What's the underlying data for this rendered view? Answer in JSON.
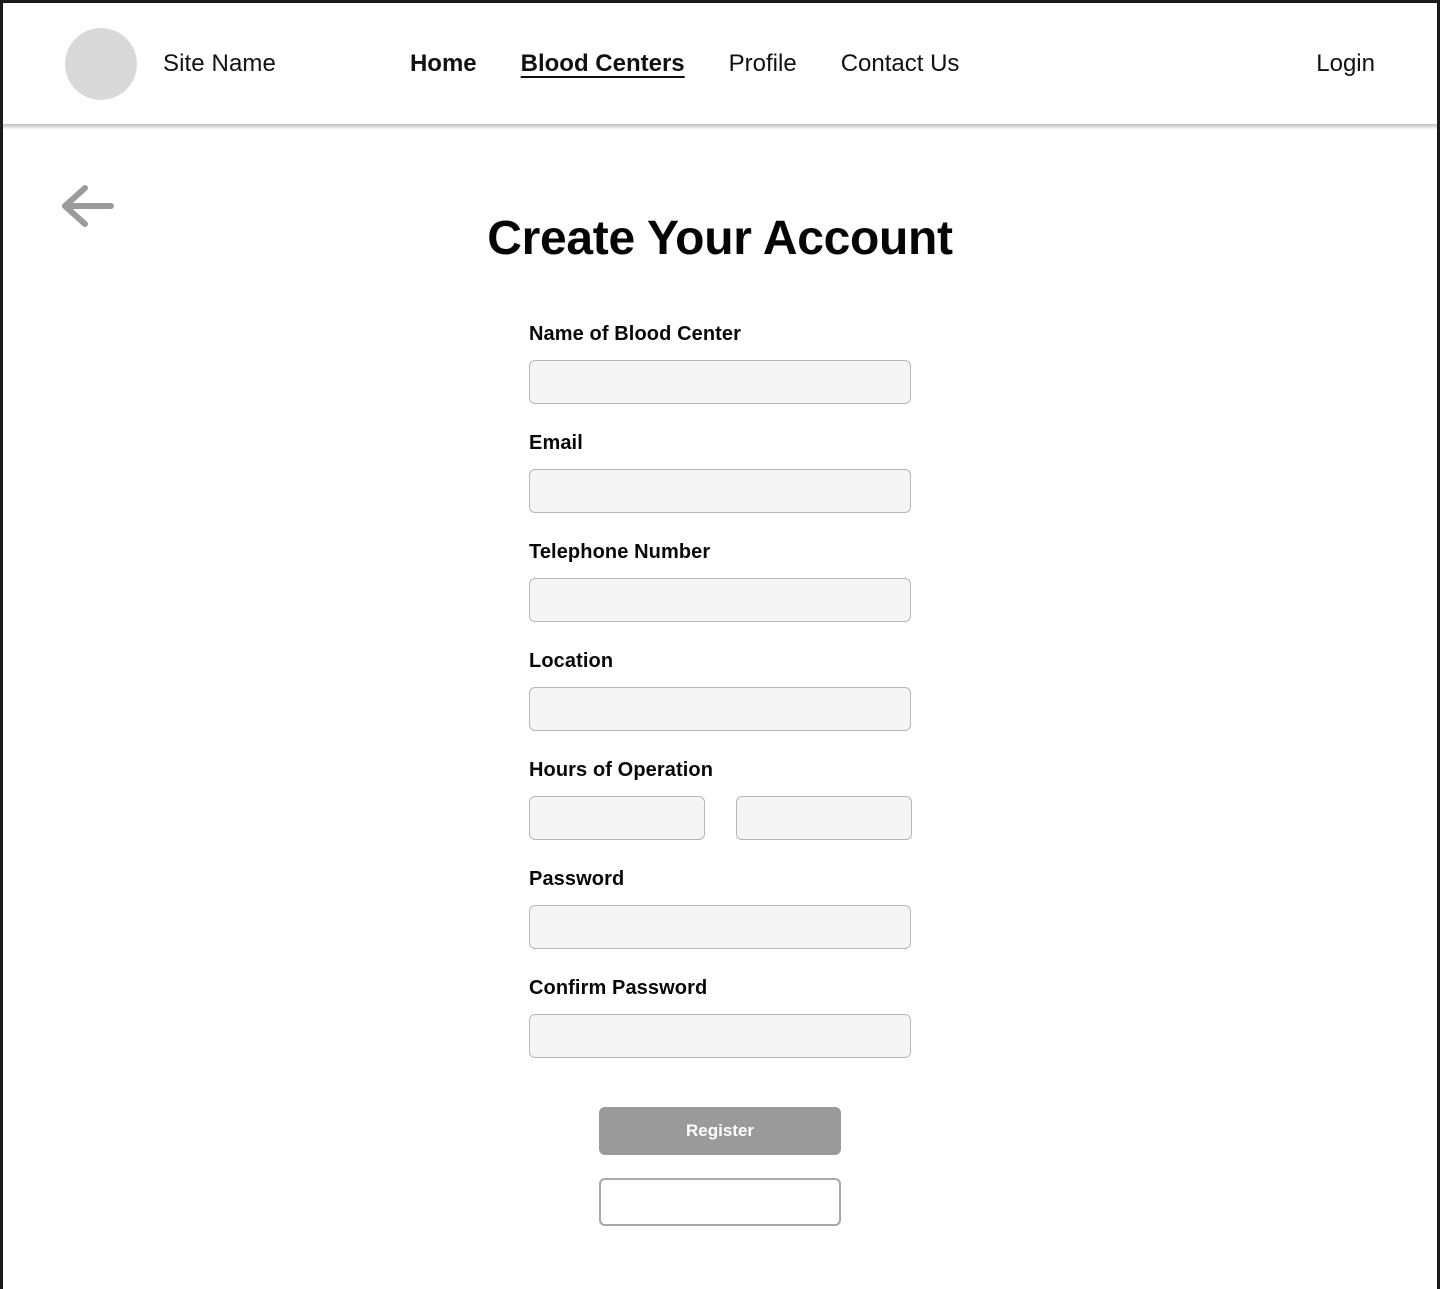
{
  "header": {
    "brand": {
      "logo_icon": "site-logo-circle",
      "name": "Site Name"
    },
    "nav": [
      {
        "label": "Home",
        "state": "strong"
      },
      {
        "label": "Blood Centers",
        "state": "active"
      },
      {
        "label": "Profile",
        "state": "normal"
      },
      {
        "label": "Contact Us",
        "state": "normal"
      }
    ],
    "login_label": "Login"
  },
  "content": {
    "back_icon": "arrow-left-icon",
    "title": "Create Your Account"
  },
  "form": {
    "fields": [
      {
        "label": "Name of Blood Center",
        "value": "",
        "placeholder": ""
      },
      {
        "label": "Email",
        "value": "",
        "placeholder": ""
      },
      {
        "label": "Telephone Number",
        "value": "",
        "placeholder": ""
      },
      {
        "label": "Location",
        "value": "",
        "placeholder": ""
      }
    ],
    "hours": {
      "label": "Hours of Operation",
      "open": {
        "value": "",
        "placeholder": ""
      },
      "close": {
        "value": "",
        "placeholder": ""
      }
    },
    "password": {
      "label": "Password",
      "value": "",
      "placeholder": ""
    },
    "confirm_password": {
      "label": "Confirm Password",
      "value": "",
      "placeholder": ""
    },
    "primary_button": "Register",
    "secondary_button": ""
  },
  "colors": {
    "button_gray": "#9a9a9a",
    "input_fill": "#f5f5f5",
    "input_border": "#b6b6b6",
    "logo_gray": "#d9d9d9",
    "text": "#111111"
  }
}
